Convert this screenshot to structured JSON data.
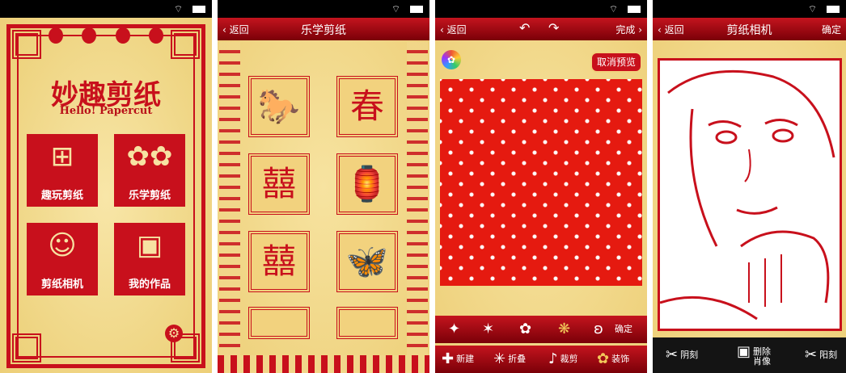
{
  "screen1": {
    "title": "妙趣剪纸",
    "subtitle": "Hello! Papercut",
    "tiles": [
      {
        "label": "趣玩剪纸"
      },
      {
        "label": "乐学剪纸"
      },
      {
        "label": "剪纸相机"
      },
      {
        "label": "我的作品"
      }
    ]
  },
  "screen2": {
    "back": "返回",
    "title": "乐学剪纸",
    "glyphs": [
      "🐎",
      "春",
      "囍",
      "🏮",
      "囍",
      "🦋"
    ]
  },
  "screen3": {
    "back": "返回",
    "done": "完成",
    "cancel_preview": "取消预览",
    "shape_tools_confirm": "确定",
    "bottom": [
      "新建",
      "折叠",
      "裁剪",
      "装饰"
    ]
  },
  "screen4": {
    "back": "返回",
    "title": "剪纸相机",
    "right": "确定",
    "bottom": [
      "阴刻",
      "删除肖像",
      "阳刻"
    ]
  },
  "colors": {
    "red": "#c8101c",
    "paper": "#f3d98c",
    "bar": "#7a0008"
  }
}
